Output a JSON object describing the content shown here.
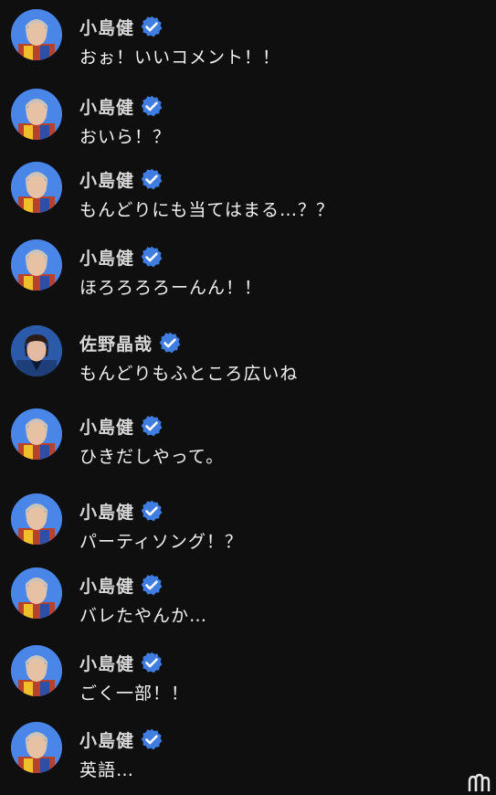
{
  "comments": [
    {
      "author": "小島健",
      "text": "おぉ！いいコメント！！",
      "verified": true,
      "avatar": "avatar-kojima"
    },
    {
      "author": "小島健",
      "text": "おいら！？",
      "verified": true,
      "avatar": "avatar-kojima"
    },
    {
      "author": "小島健",
      "text": "もんどりにも当てはまる…？？",
      "verified": true,
      "avatar": "avatar-kojima"
    },
    {
      "author": "小島健",
      "text": "ほろろろろーんん！！",
      "verified": true,
      "avatar": "avatar-kojima"
    },
    {
      "author": "佐野晶哉",
      "text": "もんどりもふところ広いね",
      "verified": true,
      "avatar": "avatar-sano"
    },
    {
      "author": "小島健",
      "text": "ひきだしやって。",
      "verified": true,
      "avatar": "avatar-kojima"
    },
    {
      "author": "小島健",
      "text": "パーティソング！？",
      "verified": true,
      "avatar": "avatar-kojima"
    },
    {
      "author": "小島健",
      "text": "バレたやんか…",
      "verified": true,
      "avatar": "avatar-kojima"
    },
    {
      "author": "小島健",
      "text": "ごく一部！！",
      "verified": true,
      "avatar": "avatar-kojima"
    },
    {
      "author": "小島健",
      "text": "英語…",
      "verified": true,
      "avatar": "avatar-kojima"
    }
  ],
  "colors": {
    "background": "#0f0f0f",
    "author": "#d8d8d8",
    "text": "#f1f1f1",
    "verified_badge": "#3f7ee0"
  },
  "icons": {
    "verified": "verified-badge-icon",
    "corner": "watermark-logo-icon"
  }
}
